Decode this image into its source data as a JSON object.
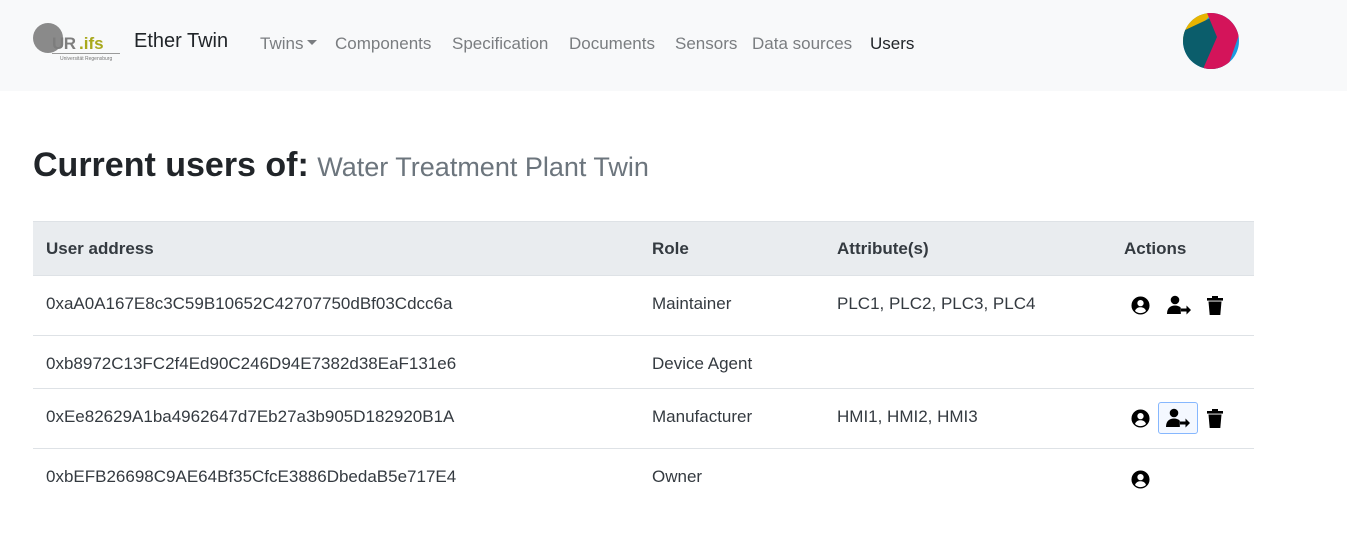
{
  "navbar": {
    "logo_text_ur": "UR",
    "logo_text_ifs": ".ifs",
    "logo_subtext": "Universität Regensburg",
    "brand": "Ether Twin",
    "items": [
      {
        "label": "Twins",
        "dropdown": true
      },
      {
        "label": "Components"
      },
      {
        "label": "Specification"
      },
      {
        "label": "Documents"
      },
      {
        "label": "Sensors"
      },
      {
        "label": "Data sources"
      },
      {
        "label": "Users",
        "active": true
      }
    ]
  },
  "page": {
    "title": "Current users of:",
    "subtitle": "Water Treatment Plant Twin"
  },
  "table": {
    "headers": [
      "User address",
      "Role",
      "Attribute(s)",
      "Actions"
    ],
    "rows": [
      {
        "address": "0xaA0A167E8c3C59B10652C42707750dBf03Cdcc6a",
        "role": "Maintainer",
        "attributes": "PLC1, PLC2, PLC3, PLC4",
        "actions": [
          "user-circle-icon",
          "user-transfer-icon",
          "trash-icon"
        ]
      },
      {
        "address": "0xb8972C13FC2f4Ed90C246D94E7382d38EaF131e6",
        "role": "Device Agent",
        "attributes": "",
        "actions": []
      },
      {
        "address": "0xEe82629A1ba4962647d7Eb27a3b905D182920B1A",
        "role": "Manufacturer",
        "attributes": "HMI1, HMI2, HMI3",
        "actions": [
          "user-circle-icon",
          "user-transfer-icon",
          "trash-icon"
        ]
      },
      {
        "address": "0xbEFB26698C9AE64Bf35CfcE3886DbedaB5e717E4",
        "role": "Owner",
        "attributes": "",
        "actions": [
          "user-circle-icon"
        ]
      }
    ]
  },
  "colors": {
    "navbar_bg": "#f8f9fa",
    "table_header_bg": "#e9ecef",
    "logo_accent": "#a8a81c",
    "focus_ring": "#86b7fe"
  }
}
